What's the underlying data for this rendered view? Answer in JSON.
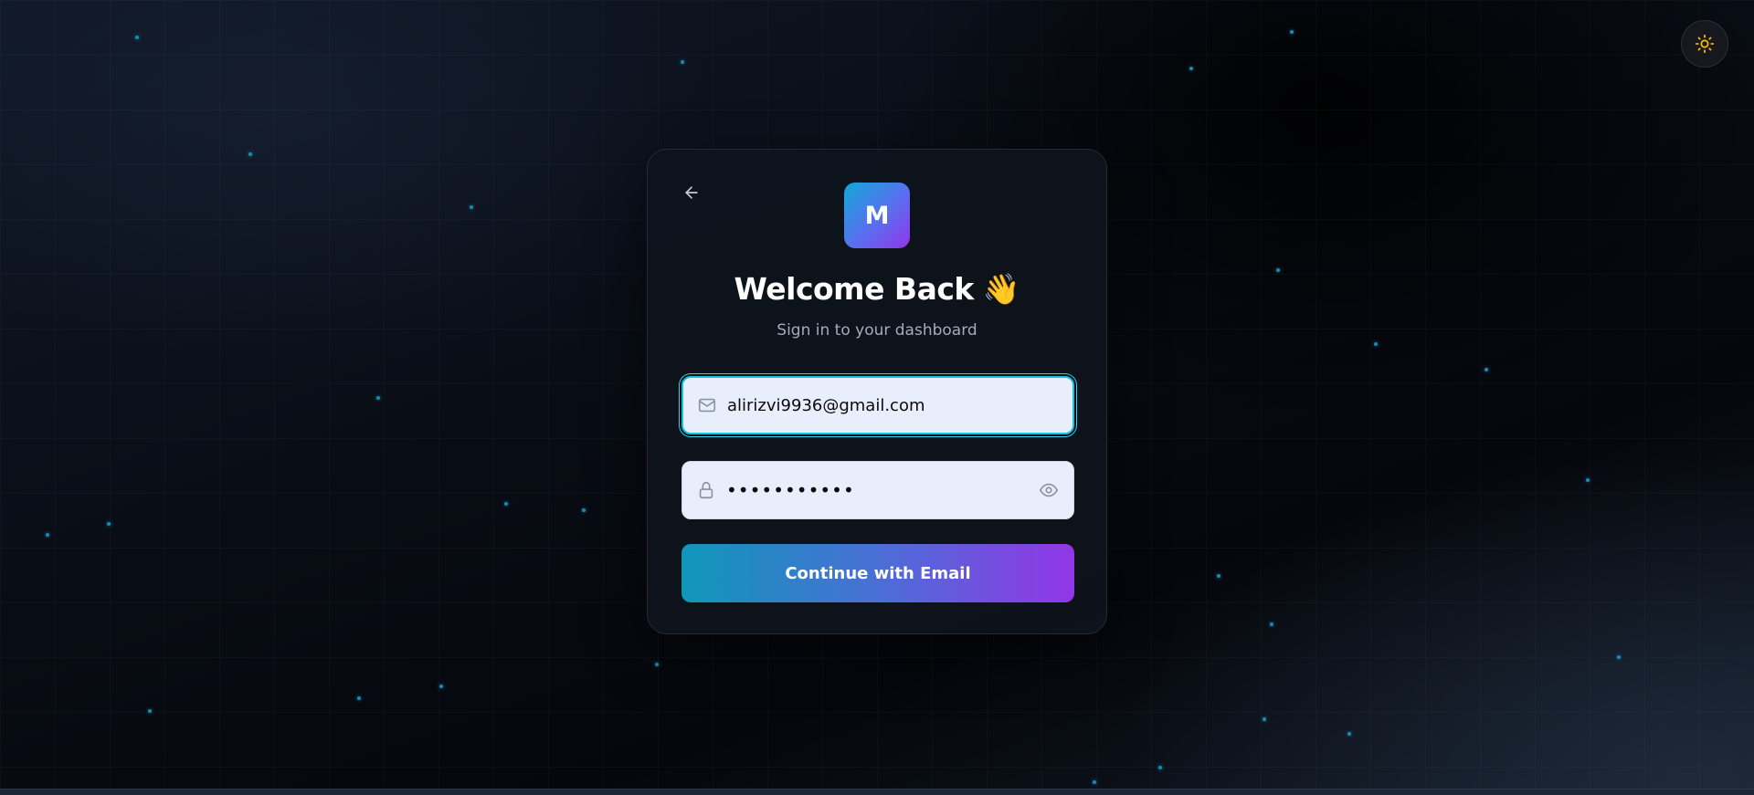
{
  "header": {
    "theme_toggle_icon": "sun-icon"
  },
  "card": {
    "back_icon": "arrow-left-icon",
    "logo_letter": "M",
    "title": "Welcome Back",
    "title_emoji": "👋",
    "subtitle": "Sign in to your dashboard"
  },
  "form": {
    "email": {
      "icon": "mail-icon",
      "value": "alirizvi9936@gmail.com"
    },
    "password": {
      "icon": "lock-icon",
      "value": "•••••••••••",
      "toggle_icon": "eye-icon"
    },
    "submit_label": "Continue with Email"
  },
  "colors": {
    "accent_cyan": "#18c3e0",
    "accent_purple": "#9236e6",
    "sun_icon": "#f5b800",
    "particle": "#1e88b4"
  }
}
